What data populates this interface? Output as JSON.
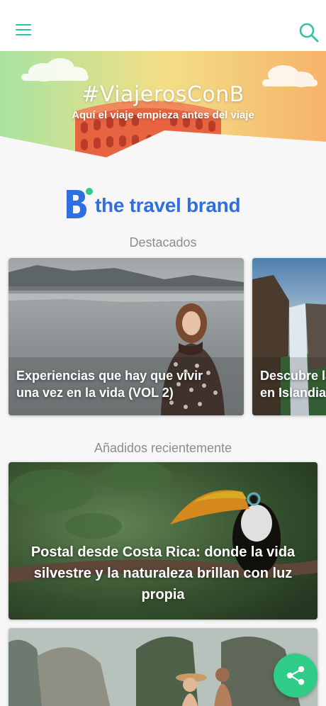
{
  "header": {
    "menu_icon": "hamburger-menu-icon",
    "search_icon": "search-icon",
    "accent_color": "#2ec4a0"
  },
  "hero": {
    "title": "#ViajerosConB",
    "subtitle": "Aquí el viaje empieza antes del viaje"
  },
  "brand": {
    "name": "the travel brand",
    "color": "#2f6fe0"
  },
  "featured": {
    "section_title": "Destacados",
    "items": [
      {
        "title": "Experiencias que hay que vivir una vez en la vida (VOL 2)"
      },
      {
        "title": "Descubre la costa sur en Islandia"
      }
    ]
  },
  "recent": {
    "section_title": "Añadidos recientemente",
    "items": [
      {
        "title": "Postal desde Costa Rica: donde la vida silvestre y la naturaleza brillan con luz propia"
      },
      {
        "title": ""
      }
    ]
  },
  "share": {
    "icon": "share-icon",
    "color": "#2ecc86"
  }
}
